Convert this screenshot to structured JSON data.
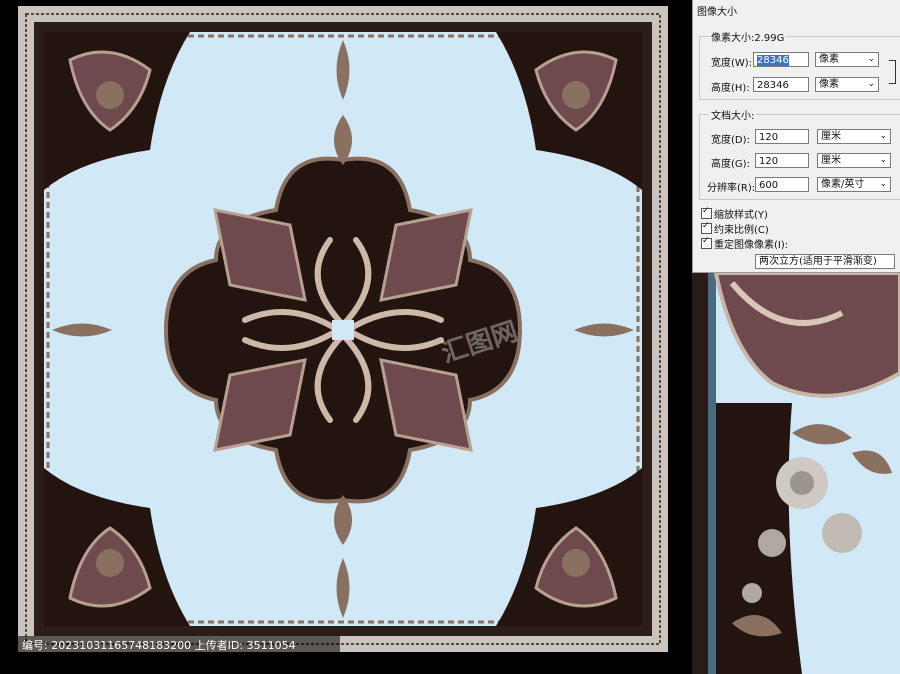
{
  "dialog": {
    "title": "图像大小",
    "pixel_group": {
      "legend": "像素大小:2.99G",
      "width_label": "宽度(W):",
      "width_value": "28346",
      "width_unit": "像素",
      "height_label": "高度(H):",
      "height_value": "28346",
      "height_unit": "像素"
    },
    "doc_group": {
      "legend": "文档大小:",
      "width_label": "宽度(D):",
      "width_value": "120",
      "width_unit": "厘米",
      "height_label": "高度(G):",
      "height_value": "120",
      "height_unit": "厘米",
      "res_label": "分辨率(R):",
      "res_value": "600",
      "res_unit": "像素/英寸"
    },
    "options": {
      "scale_styles": "缩放样式(Y)",
      "constrain": "约束比例(C)",
      "resample": "重定图像像素(I):",
      "resample_method": "两次立方(适用于平滑渐变)"
    }
  },
  "watermark": {
    "text": "编号: 20231031165748183200  上传者ID: 3511054",
    "logo": "汇图网"
  },
  "colors": {
    "background": "#d1e9f6",
    "dark": "#231410",
    "ornament": "#8a7060",
    "border": "#c9c4bd",
    "mauve": "#6e4a4e"
  }
}
